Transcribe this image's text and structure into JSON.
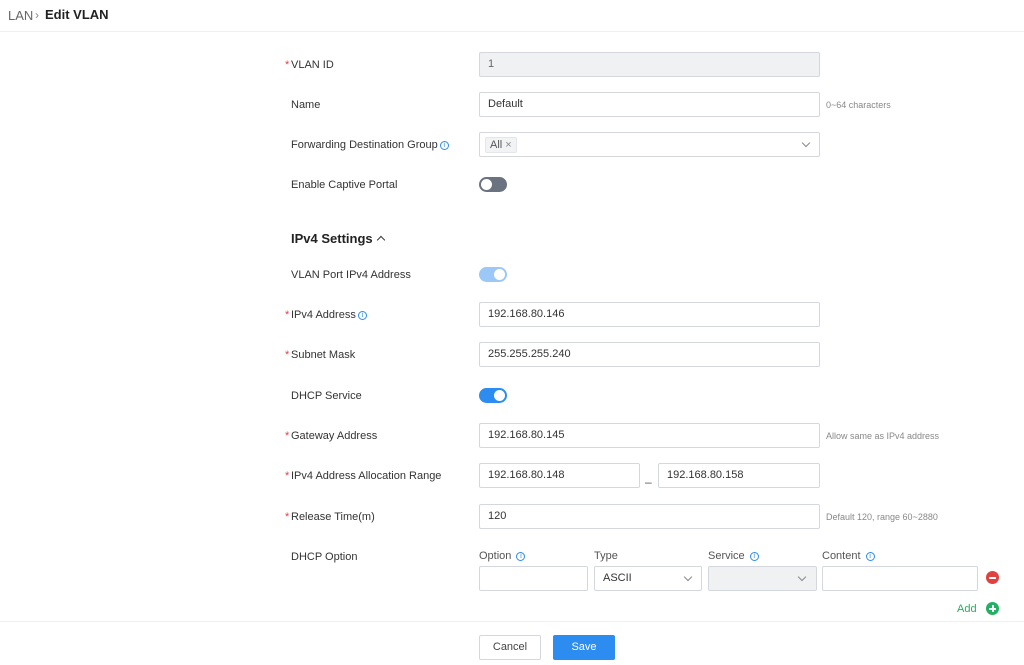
{
  "breadcrumb": {
    "parent": "LAN",
    "separator": "›",
    "current": "Edit VLAN"
  },
  "form": {
    "vlan_id": {
      "label": "VLAN ID",
      "value": "1",
      "required": true
    },
    "name": {
      "label": "Name",
      "value": "Default",
      "hint": "0~64 characters"
    },
    "forwarding_group": {
      "label": "Forwarding Destination Group",
      "tag": "All",
      "tag_close": "×"
    },
    "captive_portal": {
      "label": "Enable Captive Portal",
      "enabled": false
    }
  },
  "ipv4": {
    "title": "IPv4 Settings",
    "vlan_port": {
      "label": "VLAN Port IPv4 Address",
      "enabled": true
    },
    "address": {
      "label": "IPv4 Address",
      "value": "192.168.80.146"
    },
    "subnet": {
      "label": "Subnet Mask",
      "value": "255.255.255.240"
    },
    "dhcp_service": {
      "label": "DHCP Service",
      "enabled": true
    },
    "gateway": {
      "label": "Gateway Address",
      "value": "192.168.80.145",
      "hint": "Allow same as IPv4 address"
    },
    "range": {
      "label": "IPv4 Address Allocation Range",
      "start": "192.168.80.148",
      "separator": "–",
      "end": "192.168.80.158"
    },
    "release": {
      "label": "Release Time(m)",
      "value": "120",
      "hint": "Default 120, range 60~2880"
    },
    "dhcp_option": {
      "label": "DHCP Option",
      "columns": {
        "option": "Option",
        "type": "Type",
        "service": "Service",
        "content": "Content"
      },
      "row": {
        "option": "",
        "type": "ASCII",
        "service": "",
        "content": ""
      },
      "add_label": "Add"
    }
  },
  "footer": {
    "cancel": "Cancel",
    "save": "Save"
  },
  "required_mark": "*",
  "info_glyph": "i",
  "colors": {
    "accent": "#2d8cf0",
    "required": "#e0413f",
    "add": "#22b062",
    "toggle_off": "#6b7280"
  }
}
